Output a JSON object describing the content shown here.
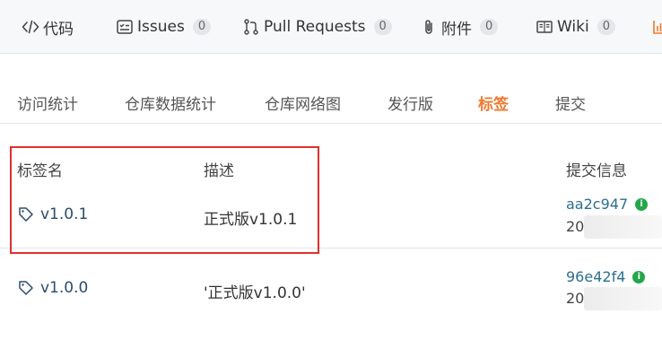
{
  "nav": {
    "tabs": [
      {
        "label": "代码",
        "icon": "code-icon"
      },
      {
        "label": "Issues",
        "icon": "issues-icon",
        "count": "0"
      },
      {
        "label": "Pull Requests",
        "icon": "pull-request-icon",
        "count": "0"
      },
      {
        "label": "附件",
        "icon": "paperclip-icon",
        "count": "0"
      },
      {
        "label": "Wiki",
        "icon": "book-icon",
        "count": "0"
      },
      {
        "label": "",
        "icon": "stats-icon"
      }
    ]
  },
  "subtabs": [
    "访问统计",
    "仓库数据统计",
    "仓库网络图",
    "发行版",
    "标签",
    "提交"
  ],
  "active_subtab": "标签",
  "table": {
    "headers": {
      "name": "标签名",
      "desc": "描述",
      "commit": "提交信息"
    },
    "rows": [
      {
        "name": "v1.0.1",
        "desc": "正式版v1.0.1",
        "commit": "aa2c947",
        "date": "20"
      },
      {
        "name": "v1.0.0",
        "desc": "'正式版v1.0.0'",
        "commit": "96e42f4",
        "date": "20"
      }
    ]
  },
  "colors": {
    "accent": "#f0782d",
    "highlight": "#e0302d",
    "verified": "#22a84a",
    "link": "#2b4d6b"
  }
}
